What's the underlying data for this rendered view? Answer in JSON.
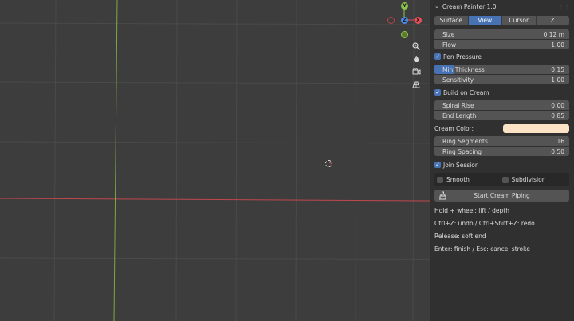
{
  "panel": {
    "title": "Cream Painter 1.0",
    "tabs": [
      {
        "label": "Surface",
        "active": false
      },
      {
        "label": "View",
        "active": true
      },
      {
        "label": "Cursor",
        "active": false
      },
      {
        "label": "Z",
        "active": false
      }
    ],
    "size": {
      "label": "Size",
      "value": "0.12 m"
    },
    "flow": {
      "label": "Flow",
      "value": "1.00"
    },
    "pen_pressure": {
      "label": "Pen Pressure",
      "checked": true
    },
    "min_thickness": {
      "label": "Min Thickness",
      "value": "0.15",
      "fill_fraction": 0.15
    },
    "sensitivity": {
      "label": "Sensitivity",
      "value": "1.00"
    },
    "build_on_cream": {
      "label": "Build on Cream",
      "checked": true
    },
    "spiral_rise": {
      "label": "Spiral Rise",
      "value": "0.00"
    },
    "end_length": {
      "label": "End Length",
      "value": "0.85"
    },
    "cream_color": {
      "label": "Cream Color:",
      "color": "#fde3c6"
    },
    "ring_segments": {
      "label": "Ring Segments",
      "value": "16"
    },
    "ring_spacing": {
      "label": "Ring Spacing",
      "value": "0.50"
    },
    "join_session": {
      "label": "Join Session",
      "checked": true
    },
    "smooth": {
      "label": "Smooth",
      "checked": false
    },
    "subdivision": {
      "label": "Subdivision",
      "checked": false
    },
    "start_button": {
      "label": "Start Cream Piping",
      "icon": "cream-piping-icon"
    },
    "hints": [
      "Hold + wheel: lift / depth",
      "Ctrl+Z: undo / Ctrl+Shift+Z: redo",
      "Release: soft end",
      "Enter: finish / Esc: cancel stroke"
    ]
  },
  "gizmo": {
    "y_label": "Y",
    "z_label": "Z",
    "x_label": "X",
    "y_color": "#8bc34a",
    "z_color": "#4a8bea",
    "x_color": "#e8505b"
  },
  "viewport": {
    "nav_icons": [
      "zoom-icon",
      "pan-hand-icon",
      "camera-icon",
      "grid-view-icon"
    ],
    "x_axis_color": "#c0484d",
    "y_axis_color": "#7fa843"
  }
}
